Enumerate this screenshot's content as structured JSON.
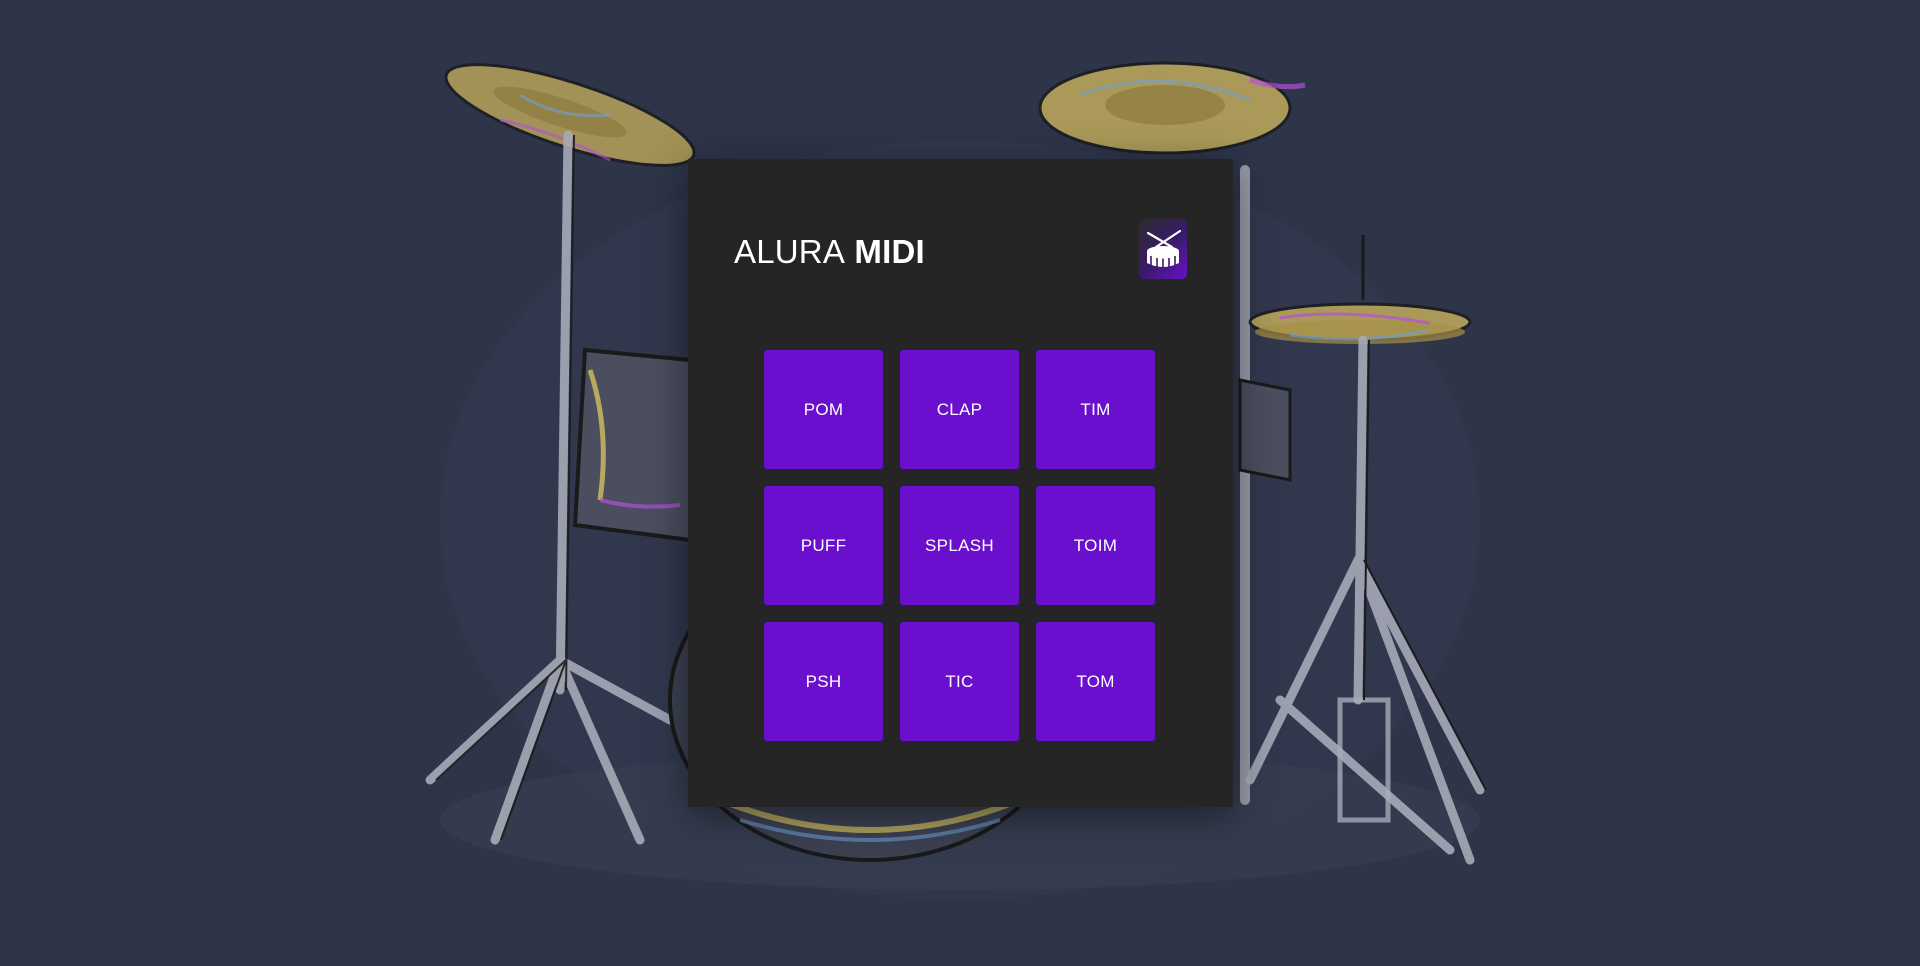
{
  "app": {
    "title_light": "ALURA",
    "title_bold": "MIDI",
    "logo_icon": "drum-icon"
  },
  "pads": [
    {
      "label": "POM"
    },
    {
      "label": "CLAP"
    },
    {
      "label": "TIM"
    },
    {
      "label": "PUFF"
    },
    {
      "label": "SPLASH"
    },
    {
      "label": "TOIM"
    },
    {
      "label": "PSH"
    },
    {
      "label": "TIC"
    },
    {
      "label": "TOM"
    }
  ],
  "colors": {
    "background": "#2e3549",
    "panel": "#252525",
    "pad": "#6b0fce",
    "text": "#ffffff"
  },
  "background_illustration": "drum-kit-sketch"
}
